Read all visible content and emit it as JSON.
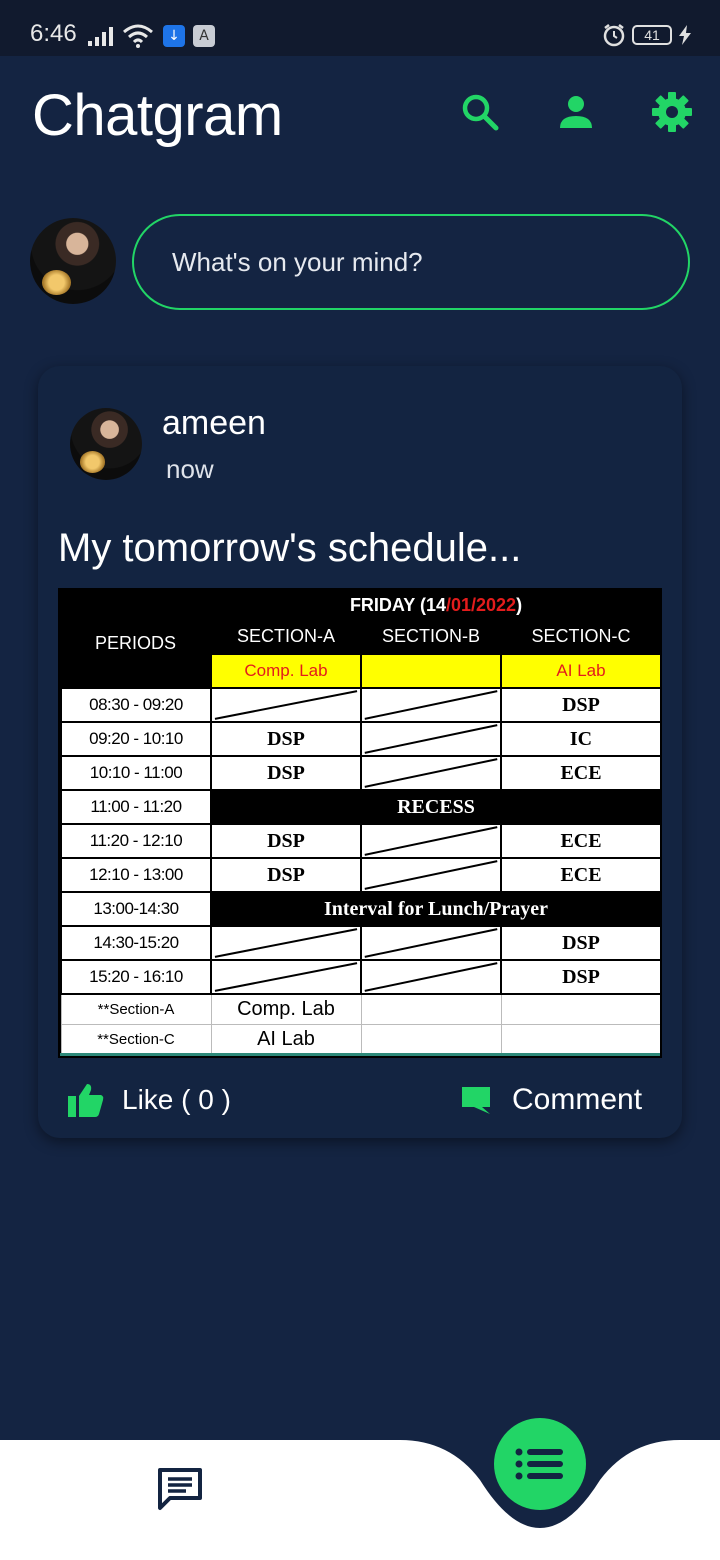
{
  "status_bar": {
    "time": "6:46",
    "battery": "41"
  },
  "app_bar": {
    "title": "Chatgram",
    "icons": [
      "search-icon",
      "person-icon",
      "gear-icon"
    ]
  },
  "composer": {
    "placeholder": "What's on your mind?"
  },
  "post": {
    "author": "ameen",
    "time": "now",
    "text": "My tomorrow's schedule...",
    "likes_label": "Like ( 0 )",
    "comment_label": "Comment",
    "schedule": {
      "day_prefix": "FRIDAY (14",
      "date_red": "/01/2022",
      "day_suffix": ")",
      "periods_header": "PERIODS",
      "sections": [
        "SECTION-A",
        "SECTION-B",
        "SECTION-C"
      ],
      "labs": [
        "Comp. Lab",
        "",
        "AI Lab"
      ],
      "rows": [
        {
          "period": "08:30 - 09:20",
          "a": "",
          "b": "",
          "c": "DSP"
        },
        {
          "period": "09:20 - 10:10",
          "a": "DSP",
          "b": "",
          "c": "IC"
        },
        {
          "period": "10:10 - 11:00",
          "a": "DSP",
          "b": "",
          "c": "ECE"
        },
        {
          "period": "11:00 - 11:20",
          "merged": "RECESS"
        },
        {
          "period": "11:20 - 12:10",
          "a": "DSP",
          "b": "",
          "c": "ECE"
        },
        {
          "period": "12:10 - 13:00",
          "a": "DSP",
          "b": "",
          "c": "ECE"
        },
        {
          "period": "13:00-14:30",
          "merged": "Interval for Lunch/Prayer"
        },
        {
          "period": "14:30-15:20",
          "a": "",
          "b": "",
          "c": "DSP"
        },
        {
          "period": "15:20 - 16:10",
          "a": "",
          "b": "",
          "c": "DSP"
        }
      ],
      "notes": [
        {
          "label": "**Section-A",
          "value": "Comp. Lab"
        },
        {
          "label": "**Section-C",
          "value": "AI Lab"
        }
      ]
    }
  },
  "bottom_nav": {
    "icons": [
      "chat-icon",
      "list-icon"
    ]
  },
  "colors": {
    "background": "#142442",
    "accent": "#22d566",
    "card": "#132441"
  }
}
